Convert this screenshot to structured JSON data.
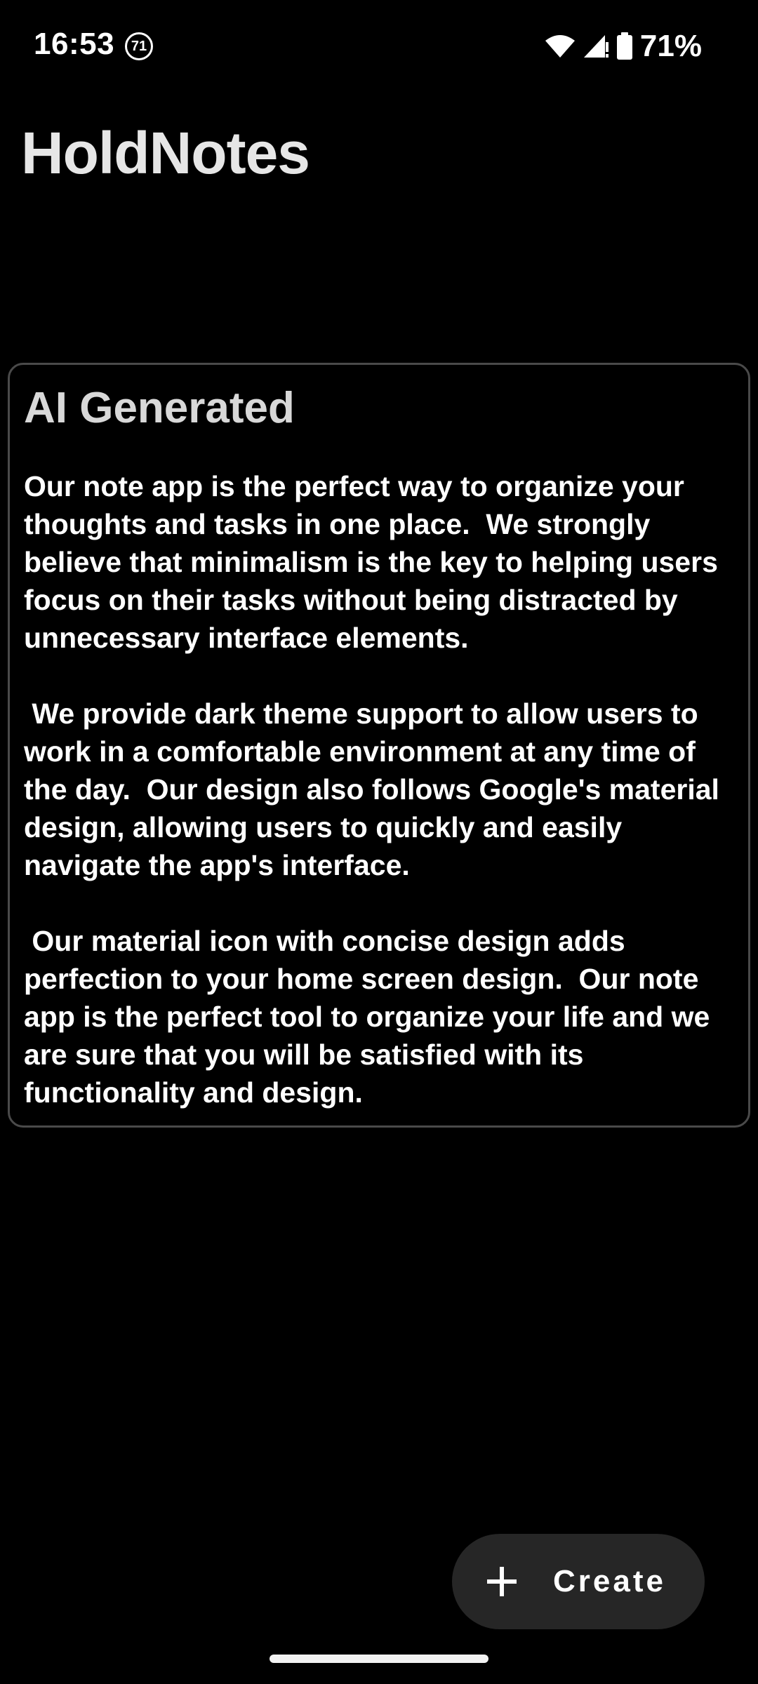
{
  "status_bar": {
    "time": "16:53",
    "notification_badge": "71",
    "battery": "71%",
    "icons": [
      "wifi-icon",
      "cell-signal-icon",
      "battery-icon"
    ]
  },
  "app": {
    "title": "HoldNotes"
  },
  "note": {
    "title": "AI Generated",
    "body": "Our note app is the perfect way to organize your thoughts and tasks in one place.  We strongly believe that minimalism is the key to helping users focus on their tasks without being distracted by unnecessary interface elements.\n\n We provide dark theme support to allow users to work in a comfortable environment at any time of the day.  Our design also follows Google's material design, allowing users to quickly and easily navigate the app's interface.\n\n Our material icon with concise design adds perfection to your home screen design.  Our note app is the perfect tool to organize your life and we are sure that you will be satisfied with its functionality and design."
  },
  "fab": {
    "label": "Create",
    "icon": "plus-icon"
  },
  "colors": {
    "background": "#000000",
    "card_border": "#4a4a4a",
    "fab_background": "#262626",
    "text": "#ffffff",
    "title_text": "#e6e6e6"
  }
}
